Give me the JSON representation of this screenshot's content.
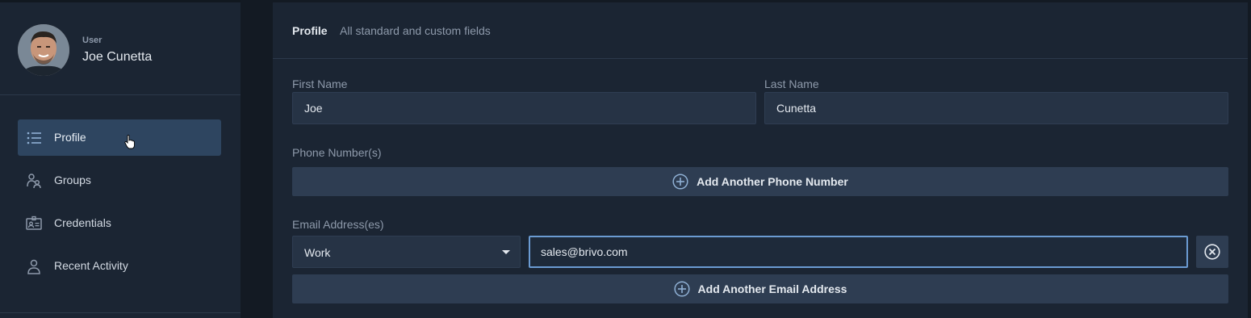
{
  "user": {
    "type_label": "User",
    "name": "Joe Cunetta"
  },
  "sidebar": {
    "items": [
      {
        "label": "Profile",
        "icon": "list-icon",
        "active": true
      },
      {
        "label": "Groups",
        "icon": "groups-icon",
        "active": false
      },
      {
        "label": "Credentials",
        "icon": "credentials-icon",
        "active": false
      },
      {
        "label": "Recent Activity",
        "icon": "person-icon",
        "active": false
      }
    ]
  },
  "main": {
    "title": "Profile",
    "subtitle": "All standard and custom fields",
    "first_name": {
      "label": "First Name",
      "value": "Joe"
    },
    "last_name": {
      "label": "Last Name",
      "value": "Cunetta"
    },
    "phone": {
      "label": "Phone Number(s)",
      "add_label": "Add Another Phone Number"
    },
    "email": {
      "label": "Email Address(es)",
      "type_selected": "Work",
      "value": "sales@brivo.com",
      "add_label": "Add Another Email Address"
    }
  },
  "colors": {
    "accent": "#6b9bd2",
    "active_nav": "#2e4560",
    "panel": "#1b2533"
  }
}
